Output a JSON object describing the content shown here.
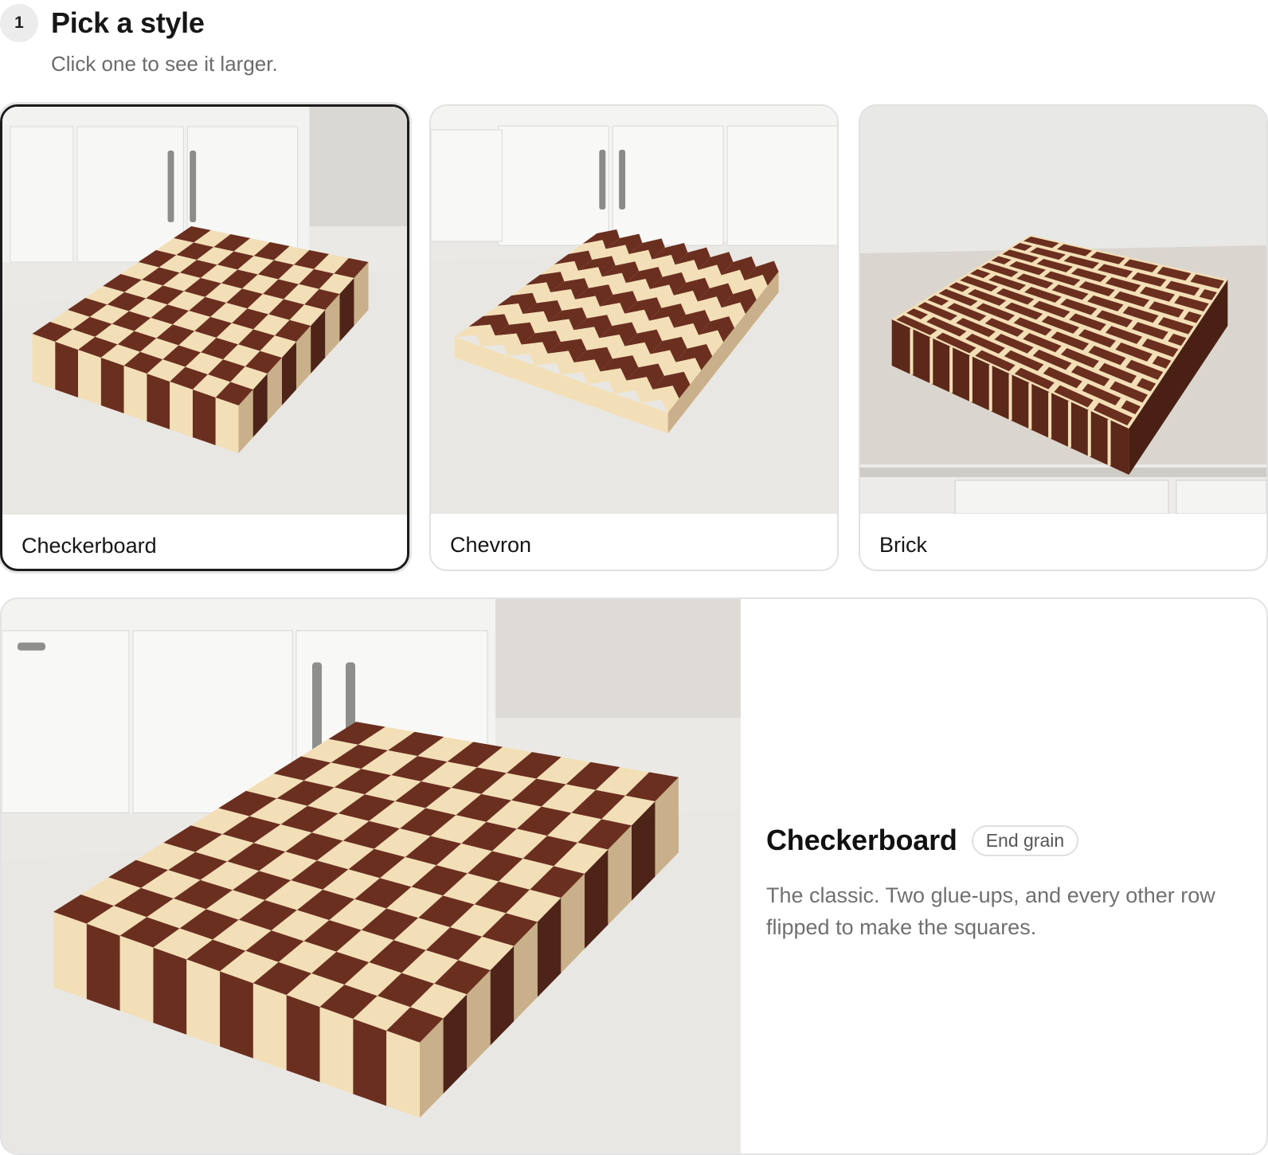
{
  "step": {
    "number": "1",
    "title": "Pick a style",
    "subtitle": "Click one to see it larger."
  },
  "styles": [
    {
      "label": "Checkerboard",
      "pattern": "checkerboard",
      "selected": true
    },
    {
      "label": "Chevron",
      "pattern": "chevron",
      "selected": false
    },
    {
      "label": "Brick",
      "pattern": "brick",
      "selected": false
    }
  ],
  "detail": {
    "title": "Checkerboard",
    "badge": "End grain",
    "description": "The classic. Two glue-ups, and every other row flipped to make the squares."
  },
  "colors": {
    "dark_wood": "#6b2f1f",
    "light_wood": "#f3dfb7",
    "counter": "#ebe9e5",
    "cabinet": "#f4f4f3",
    "selected_border": "#1b1b1b"
  }
}
